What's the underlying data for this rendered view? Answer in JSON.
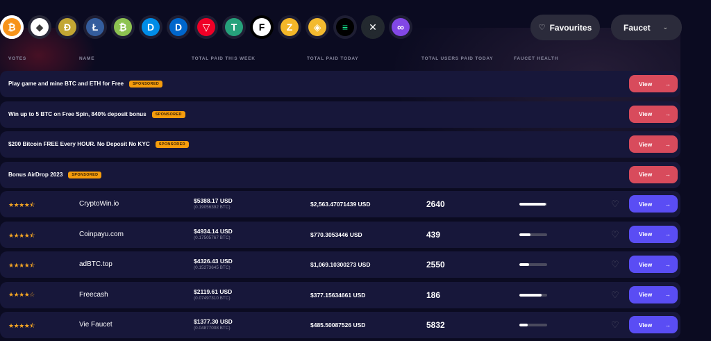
{
  "coins": [
    {
      "name": "bitcoin-icon",
      "glyph": "₿",
      "bg": "#f7931a",
      "fg": "#ffffff",
      "ring": "#ffffff"
    },
    {
      "name": "ethereum-icon",
      "glyph": "◆",
      "bg": "#ffffff",
      "fg": "#3c3c3d",
      "ring": "#2a2a3a"
    },
    {
      "name": "dogecoin-icon",
      "glyph": "Ð",
      "bg": "#c2a633",
      "fg": "#ffffff",
      "ring": "#1e1e33"
    },
    {
      "name": "litecoin-icon",
      "glyph": "Ł",
      "bg": "#345d9d",
      "fg": "#ffffff",
      "ring": "#1e1e33"
    },
    {
      "name": "bitcoin-cash-icon",
      "glyph": "₿",
      "bg": "#8dc351",
      "fg": "#ffffff",
      "ring": "#1e1e33"
    },
    {
      "name": "dash-icon",
      "glyph": "D",
      "bg": "#008ce7",
      "fg": "#ffffff",
      "ring": "#1e1e33"
    },
    {
      "name": "digibyte-icon",
      "glyph": "D",
      "bg": "#0066cc",
      "fg": "#ffffff",
      "ring": "#1e1e33"
    },
    {
      "name": "tron-icon",
      "glyph": "▽",
      "bg": "#ef0027",
      "fg": "#ffffff",
      "ring": "#1e1e33"
    },
    {
      "name": "tether-icon",
      "glyph": "T",
      "bg": "#26a17b",
      "fg": "#ffffff",
      "ring": "#1e1e33"
    },
    {
      "name": "feyorra-icon",
      "glyph": "F",
      "bg": "#ffffff",
      "fg": "#000000",
      "ring": "#000000"
    },
    {
      "name": "zcash-icon",
      "glyph": "Z",
      "bg": "#f4b728",
      "fg": "#ffffff",
      "ring": "#1e1e33"
    },
    {
      "name": "binance-icon",
      "glyph": "◈",
      "bg": "#f3ba2f",
      "fg": "#ffffff",
      "ring": "#1e1e33"
    },
    {
      "name": "solana-icon",
      "glyph": "≡",
      "bg": "#000000",
      "fg": "#14f195",
      "ring": "#1e1e33"
    },
    {
      "name": "xrp-icon",
      "glyph": "✕",
      "bg": "#23292f",
      "fg": "#ffffff",
      "ring": "#23292f"
    },
    {
      "name": "polygon-icon",
      "glyph": "∞",
      "bg": "#8247e5",
      "fg": "#ffffff",
      "ring": "#1e1e33"
    }
  ],
  "top": {
    "favourites": "Favourites",
    "faucet": "Faucet"
  },
  "headers": {
    "votes": "VOTES",
    "name": "NAME",
    "total_week": "TOTAL PAID THIS WEEK",
    "total_today": "TOTAL PAID TODAY",
    "users_today": "TOTAL USERS PAID TODAY",
    "health": "FAUCET HEALTH"
  },
  "sponsored_label": "SPONSORED",
  "view_label": "View",
  "sponsored": [
    {
      "title": "Play game and mine BTC and ETH for Free"
    },
    {
      "title": "Win up to 5 BTC on Free Spin, 840% deposit bonus"
    },
    {
      "title": "$200 Bitcoin FREE Every HOUR. No Deposit No KYC"
    },
    {
      "title": "Bonus AirDrop 2023"
    }
  ],
  "faucets": [
    {
      "stars": "★★★★⯪",
      "name": "CryptoWin.io",
      "week_usd": "$5388.17 USD",
      "week_btc": "(0.19056392 BTC)",
      "today": "$2,563.47071439 USD",
      "users": "2640",
      "health": 0.95
    },
    {
      "stars": "★★★★⯪",
      "name": "Coinpayu.com",
      "week_usd": "$4934.14 USD",
      "week_btc": "(0.17505767 BTC)",
      "today": "$770.3053446 USD",
      "users": "439",
      "health": 0.4
    },
    {
      "stars": "★★★★⯪",
      "name": "adBTC.top",
      "week_usd": "$4326.43 USD",
      "week_btc": "(0.15273645 BTC)",
      "today": "$1,069.10300273 USD",
      "users": "2550",
      "health": 0.35
    },
    {
      "stars": "★★★★☆",
      "name": "Freecash",
      "week_usd": "$2119.61 USD",
      "week_btc": "(0.07497310 BTC)",
      "today": "$377.15634661 USD",
      "users": "186",
      "health": 0.8
    },
    {
      "stars": "★★★★⯪",
      "name": "Vie Faucet",
      "week_usd": "$1377.30 USD",
      "week_btc": "(0.04877008 BTC)",
      "today": "$485.50087526 USD",
      "users": "5832",
      "health": 0.3
    }
  ]
}
